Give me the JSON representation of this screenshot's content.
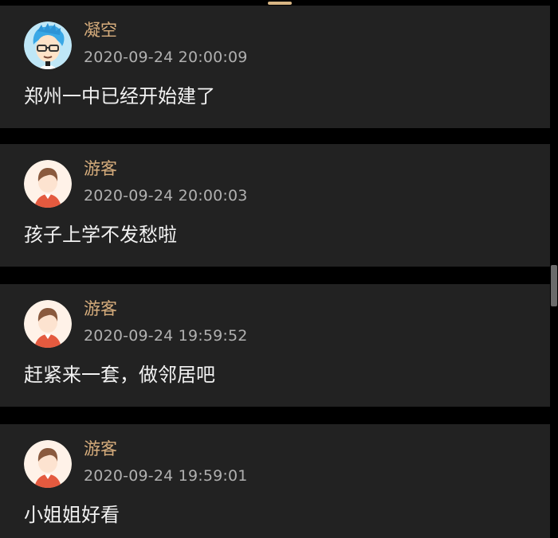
{
  "comments": [
    {
      "username": "凝空",
      "timestamp": "2020-09-24 20:00:09",
      "text": "郑州一中已经开始建了",
      "avatar": "user-avatar-blue-hair-glasses"
    },
    {
      "username": "游客",
      "timestamp": "2020-09-24 20:00:03",
      "text": "孩子上学不发愁啦",
      "avatar": "guest-avatar"
    },
    {
      "username": "游客",
      "timestamp": "2020-09-24 19:59:52",
      "text": "赶紧来一套，做邻居吧",
      "avatar": "guest-avatar"
    },
    {
      "username": "游客",
      "timestamp": "2020-09-24 19:59:01",
      "text": "小姐姐好看",
      "avatar": "guest-avatar"
    }
  ],
  "colors": {
    "background": "#000000",
    "card": "#222222",
    "username": "#d8ae7d",
    "timestamp": "#b0b0b0",
    "comment": "#f2f2f2"
  }
}
